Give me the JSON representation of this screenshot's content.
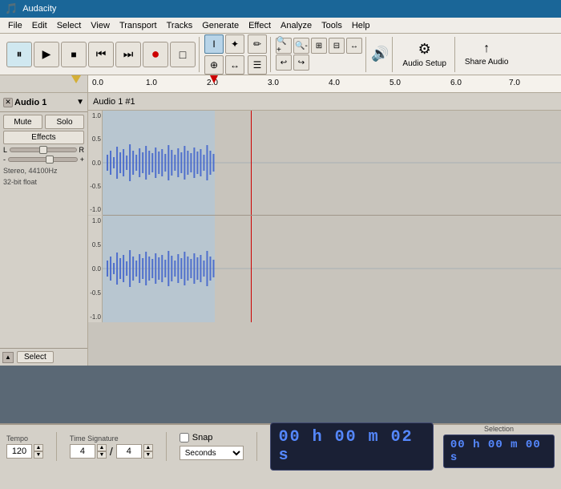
{
  "titlebar": {
    "title": "Audacity",
    "icon": "🎵"
  },
  "menu": {
    "items": [
      "File",
      "Edit",
      "Select",
      "View",
      "Transport",
      "Tracks",
      "Generate",
      "Effect",
      "Analyze",
      "Tools",
      "Help"
    ]
  },
  "toolbar": {
    "pause_label": "⏸",
    "play_label": "▶",
    "stop_label": "■",
    "prev_label": "⏮",
    "next_label": "⏭",
    "record_label": "●",
    "monitor_label": "□",
    "tools": [
      "I",
      "✦",
      "⊕",
      "↔",
      "✏",
      "☰"
    ],
    "zoom_in": "+",
    "zoom_out": "-",
    "zoom_sel": "⊞",
    "zoom_fit": "⊟",
    "zoom_width": "↔",
    "zoom_undo": "↩",
    "zoom_redo": "↪",
    "audio_setup": "Audio Setup",
    "share_audio": "Share Audio"
  },
  "ruler": {
    "markers": [
      "0.0",
      "1.0",
      "2.0",
      "3.0",
      "4.0",
      "5.0",
      "6.0",
      "7.0"
    ]
  },
  "track": {
    "name": "Audio 1",
    "label": "Audio 1 #1",
    "mute": "Mute",
    "solo": "Solo",
    "effects": "Effects",
    "pan_l": "L",
    "pan_r": "R",
    "info_line1": "Stereo, 44100Hz",
    "info_line2": "32-bit float"
  },
  "bottom_bar": {
    "tempo_label": "Tempo",
    "tempo_value": "120",
    "time_sig_label": "Time Signature",
    "time_sig_num": "4",
    "time_sig_den": "4",
    "snap_label": "Snap",
    "seconds_label": "Seconds",
    "time_display": "00 h 00 m 02 s",
    "selection_label": "Selection",
    "selection_time": "00 h 00 m 00 s"
  },
  "select_btn": "Select",
  "waveform": {
    "selected_width": 140
  }
}
